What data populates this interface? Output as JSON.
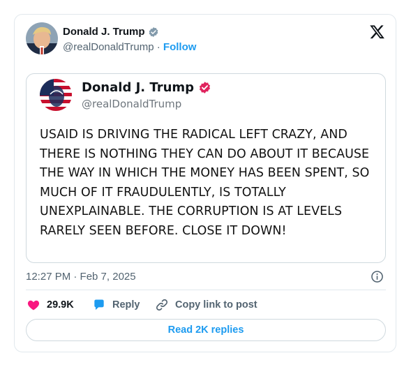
{
  "author": {
    "name": "Donald J. Trump",
    "handle": "@realDonaldTrump",
    "separator": "·",
    "follow_label": "Follow"
  },
  "quoted_post": {
    "name": "Donald J. Trump",
    "handle": "@realDonaldTrump",
    "text": "USAID IS DRIVING THE RADICAL LEFT CRAZY, AND THERE IS NOTHING THEY CAN DO ABOUT IT BECAUSE THE WAY IN WHICH THE MONEY HAS BEEN SPENT, SO MUCH OF IT FRAUDULENTLY, IS TOTALLY UNEXPLAINABLE. THE CORRUPTION IS AT LEVELS RARELY SEEN BEFORE. CLOSE IT DOWN!"
  },
  "timestamp": "12:27 PM · Feb 7, 2025",
  "actions": {
    "likes": "29.9K",
    "reply_label": "Reply",
    "copy_label": "Copy link to post"
  },
  "read_replies_label": "Read 2K replies",
  "colors": {
    "accent": "#1d9bf0",
    "like": "#f91880",
    "truth_badge": "#e0245e",
    "muted": "#536471"
  },
  "icons": {
    "verified": "verified-badge-icon",
    "x_logo": "x-logo-icon",
    "info": "info-icon",
    "heart": "heart-icon",
    "reply": "reply-bubble-icon",
    "link": "link-icon"
  }
}
